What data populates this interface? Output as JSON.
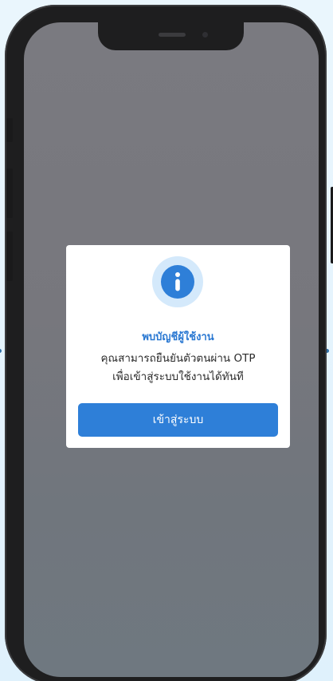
{
  "dialog": {
    "icon": "info-icon",
    "title": "พบบัญชีผู้ใช้งาน",
    "message_line1": "คุณสามารถยืนยันตัวตนผ่าน OTP",
    "message_line2": "เพื่อเข้าสู่ระบบใช้งานได้ทันที",
    "button_label": "เข้าสู่ระบบ"
  },
  "colors": {
    "accent": "#2e7fd8",
    "accent_light": "#d4e9fb",
    "title_text": "#2a78d2",
    "overlay": "#77777d",
    "background": "#e4f3fd",
    "device": "#1e1e1f"
  }
}
